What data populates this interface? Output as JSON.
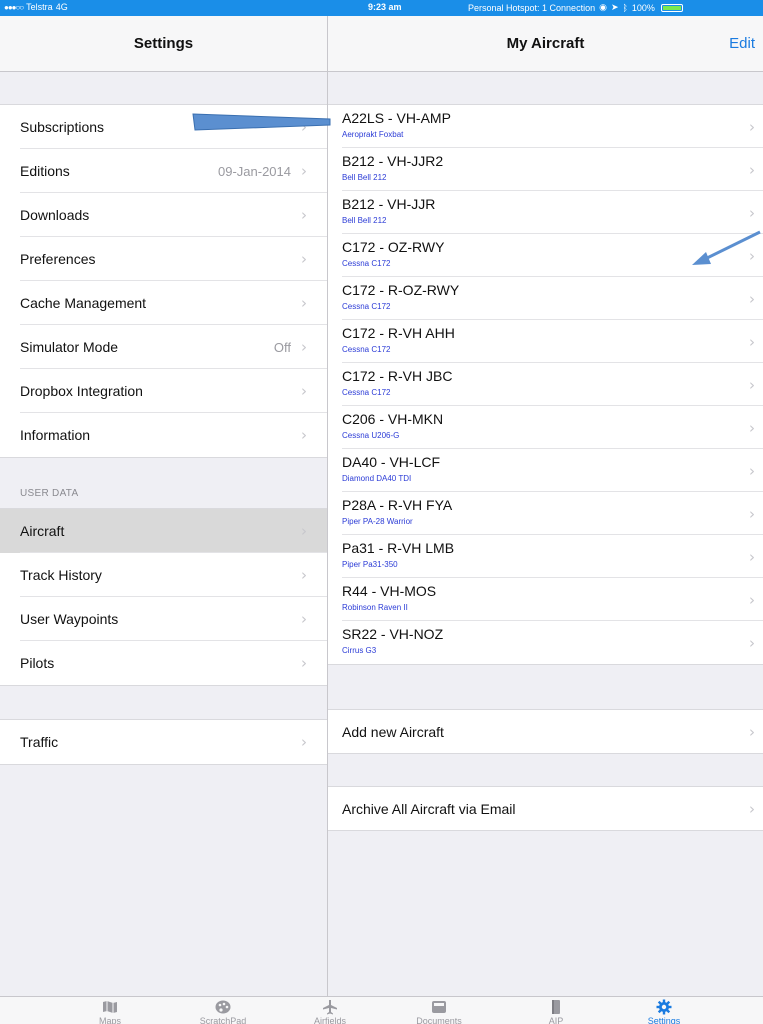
{
  "status_bar": {
    "carrier": "Telstra",
    "network": "4G",
    "time": "9:23 am",
    "hotspot": "Personal Hotspot: 1 Connection",
    "battery": "100%",
    "battery_level": 1.0
  },
  "settings_nav": {
    "title": "Settings"
  },
  "aircraft_nav": {
    "title": "My Aircraft",
    "edit_label": "Edit"
  },
  "settings_groups": {
    "main": [
      {
        "label": "Subscriptions",
        "value": ""
      },
      {
        "label": "Editions",
        "value": "09-Jan-2014"
      },
      {
        "label": "Downloads",
        "value": ""
      },
      {
        "label": "Preferences",
        "value": ""
      },
      {
        "label": "Cache Management",
        "value": ""
      },
      {
        "label": "Simulator Mode",
        "value": "Off"
      },
      {
        "label": "Dropbox Integration",
        "value": ""
      },
      {
        "label": "Information",
        "value": ""
      }
    ],
    "user_data_header": "USER DATA",
    "user_data": [
      {
        "label": "Aircraft",
        "value": ""
      },
      {
        "label": "Track History",
        "value": ""
      },
      {
        "label": "User Waypoints",
        "value": ""
      },
      {
        "label": "Pilots",
        "value": ""
      }
    ],
    "other": [
      {
        "label": "Traffic",
        "value": ""
      }
    ]
  },
  "aircraft_list": [
    {
      "title": "A22LS - VH-AMP",
      "subtitle": "Aeroprakt Foxbat"
    },
    {
      "title": "B212 - VH-JJR2",
      "subtitle": "Bell Bell 212"
    },
    {
      "title": "B212 - VH-JJR",
      "subtitle": "Bell Bell 212"
    },
    {
      "title": "C172 - OZ-RWY",
      "subtitle": "Cessna C172"
    },
    {
      "title": "C172 - R-OZ-RWY",
      "subtitle": "Cessna C172"
    },
    {
      "title": "C172 - R-VH AHH",
      "subtitle": "Cessna C172"
    },
    {
      "title": "C172 - R-VH JBC",
      "subtitle": "Cessna C172"
    },
    {
      "title": "C206 - VH-MKN",
      "subtitle": "Cessna U206-G"
    },
    {
      "title": "DA40 - VH-LCF",
      "subtitle": "Diamond DA40 TDI"
    },
    {
      "title": "P28A - R-VH FYA",
      "subtitle": "Piper PA-28 Warrior"
    },
    {
      "title": "Pa31 - R-VH LMB",
      "subtitle": "Piper Pa31-350"
    },
    {
      "title": "R44 - VH-MOS",
      "subtitle": "Robinson Raven II"
    },
    {
      "title": "SR22 - VH-NOZ",
      "subtitle": "Cirrus G3"
    }
  ],
  "actions": {
    "add_aircraft": "Add new Aircraft",
    "archive_aircraft": "Archive All Aircraft via Email"
  },
  "tabs": [
    {
      "label": "Maps",
      "icon": "map-icon"
    },
    {
      "label": "ScratchPad",
      "icon": "palette-icon"
    },
    {
      "label": "Airfields",
      "icon": "airplane-icon"
    },
    {
      "label": "Documents",
      "icon": "folder-icon"
    },
    {
      "label": "AIP",
      "icon": "book-icon"
    },
    {
      "label": "Settings",
      "icon": "gear-icon"
    }
  ],
  "colors": {
    "accent": "#1a7be0",
    "status_bar": "#1a8ee8",
    "subtitle": "#2b3bd6",
    "annotation_arrow": "#5b8fd0"
  }
}
